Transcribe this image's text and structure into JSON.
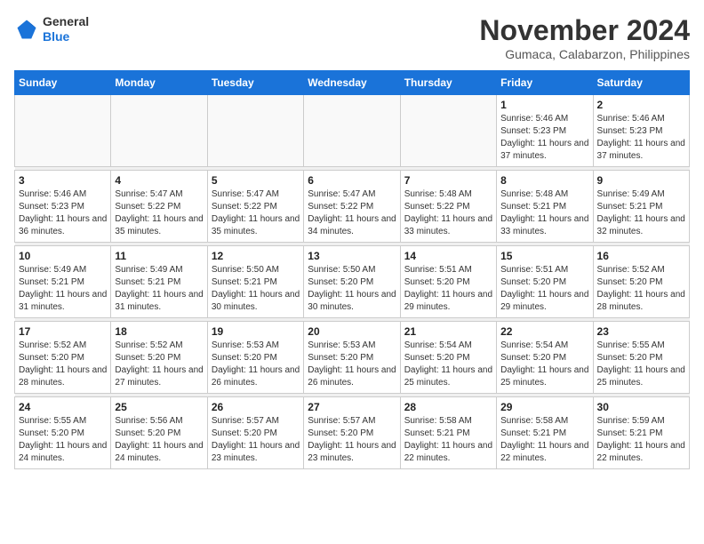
{
  "logo": {
    "general": "General",
    "blue": "Blue"
  },
  "header": {
    "month": "November 2024",
    "location": "Gumaca, Calabarzon, Philippines"
  },
  "weekdays": [
    "Sunday",
    "Monday",
    "Tuesday",
    "Wednesday",
    "Thursday",
    "Friday",
    "Saturday"
  ],
  "weeks": [
    [
      {
        "day": "",
        "info": ""
      },
      {
        "day": "",
        "info": ""
      },
      {
        "day": "",
        "info": ""
      },
      {
        "day": "",
        "info": ""
      },
      {
        "day": "",
        "info": ""
      },
      {
        "day": "1",
        "info": "Sunrise: 5:46 AM\nSunset: 5:23 PM\nDaylight: 11 hours and 37 minutes."
      },
      {
        "day": "2",
        "info": "Sunrise: 5:46 AM\nSunset: 5:23 PM\nDaylight: 11 hours and 37 minutes."
      }
    ],
    [
      {
        "day": "3",
        "info": "Sunrise: 5:46 AM\nSunset: 5:23 PM\nDaylight: 11 hours and 36 minutes."
      },
      {
        "day": "4",
        "info": "Sunrise: 5:47 AM\nSunset: 5:22 PM\nDaylight: 11 hours and 35 minutes."
      },
      {
        "day": "5",
        "info": "Sunrise: 5:47 AM\nSunset: 5:22 PM\nDaylight: 11 hours and 35 minutes."
      },
      {
        "day": "6",
        "info": "Sunrise: 5:47 AM\nSunset: 5:22 PM\nDaylight: 11 hours and 34 minutes."
      },
      {
        "day": "7",
        "info": "Sunrise: 5:48 AM\nSunset: 5:22 PM\nDaylight: 11 hours and 33 minutes."
      },
      {
        "day": "8",
        "info": "Sunrise: 5:48 AM\nSunset: 5:21 PM\nDaylight: 11 hours and 33 minutes."
      },
      {
        "day": "9",
        "info": "Sunrise: 5:49 AM\nSunset: 5:21 PM\nDaylight: 11 hours and 32 minutes."
      }
    ],
    [
      {
        "day": "10",
        "info": "Sunrise: 5:49 AM\nSunset: 5:21 PM\nDaylight: 11 hours and 31 minutes."
      },
      {
        "day": "11",
        "info": "Sunrise: 5:49 AM\nSunset: 5:21 PM\nDaylight: 11 hours and 31 minutes."
      },
      {
        "day": "12",
        "info": "Sunrise: 5:50 AM\nSunset: 5:21 PM\nDaylight: 11 hours and 30 minutes."
      },
      {
        "day": "13",
        "info": "Sunrise: 5:50 AM\nSunset: 5:20 PM\nDaylight: 11 hours and 30 minutes."
      },
      {
        "day": "14",
        "info": "Sunrise: 5:51 AM\nSunset: 5:20 PM\nDaylight: 11 hours and 29 minutes."
      },
      {
        "day": "15",
        "info": "Sunrise: 5:51 AM\nSunset: 5:20 PM\nDaylight: 11 hours and 29 minutes."
      },
      {
        "day": "16",
        "info": "Sunrise: 5:52 AM\nSunset: 5:20 PM\nDaylight: 11 hours and 28 minutes."
      }
    ],
    [
      {
        "day": "17",
        "info": "Sunrise: 5:52 AM\nSunset: 5:20 PM\nDaylight: 11 hours and 28 minutes."
      },
      {
        "day": "18",
        "info": "Sunrise: 5:52 AM\nSunset: 5:20 PM\nDaylight: 11 hours and 27 minutes."
      },
      {
        "day": "19",
        "info": "Sunrise: 5:53 AM\nSunset: 5:20 PM\nDaylight: 11 hours and 26 minutes."
      },
      {
        "day": "20",
        "info": "Sunrise: 5:53 AM\nSunset: 5:20 PM\nDaylight: 11 hours and 26 minutes."
      },
      {
        "day": "21",
        "info": "Sunrise: 5:54 AM\nSunset: 5:20 PM\nDaylight: 11 hours and 25 minutes."
      },
      {
        "day": "22",
        "info": "Sunrise: 5:54 AM\nSunset: 5:20 PM\nDaylight: 11 hours and 25 minutes."
      },
      {
        "day": "23",
        "info": "Sunrise: 5:55 AM\nSunset: 5:20 PM\nDaylight: 11 hours and 25 minutes."
      }
    ],
    [
      {
        "day": "24",
        "info": "Sunrise: 5:55 AM\nSunset: 5:20 PM\nDaylight: 11 hours and 24 minutes."
      },
      {
        "day": "25",
        "info": "Sunrise: 5:56 AM\nSunset: 5:20 PM\nDaylight: 11 hours and 24 minutes."
      },
      {
        "day": "26",
        "info": "Sunrise: 5:57 AM\nSunset: 5:20 PM\nDaylight: 11 hours and 23 minutes."
      },
      {
        "day": "27",
        "info": "Sunrise: 5:57 AM\nSunset: 5:20 PM\nDaylight: 11 hours and 23 minutes."
      },
      {
        "day": "28",
        "info": "Sunrise: 5:58 AM\nSunset: 5:21 PM\nDaylight: 11 hours and 22 minutes."
      },
      {
        "day": "29",
        "info": "Sunrise: 5:58 AM\nSunset: 5:21 PM\nDaylight: 11 hours and 22 minutes."
      },
      {
        "day": "30",
        "info": "Sunrise: 5:59 AM\nSunset: 5:21 PM\nDaylight: 11 hours and 22 minutes."
      }
    ]
  ]
}
